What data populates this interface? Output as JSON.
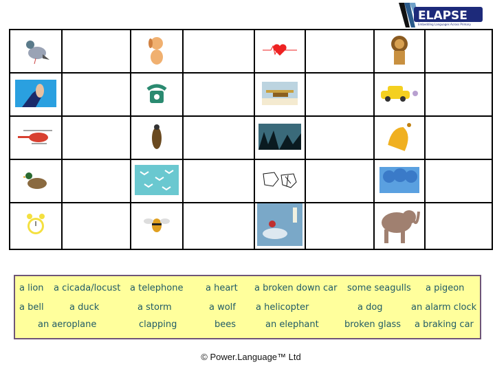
{
  "logo": {
    "text": "ELAPSE",
    "subtitle": "Embedding Languages Across Primary and Secondary Education"
  },
  "grid": {
    "rows": [
      [
        "pigeon-image",
        "dog-image",
        "heart-image",
        "lion-image"
      ],
      [
        "clapping-image",
        "telephone-image",
        "aeroplane-image",
        "braking-car-image"
      ],
      [
        "helicopter-image",
        "cicada-image",
        "wolf-image",
        "bell-image"
      ],
      [
        "duck-image",
        "seagulls-image",
        "broken-glass-image",
        "storm-image"
      ],
      [
        "alarm-clock-image",
        "bees-image",
        "broken-down-car-image",
        "elephant-image"
      ]
    ]
  },
  "words": [
    "a lion",
    "a cicada/locust",
    "a telephone",
    "a heart",
    "a broken down car",
    "some seagulls",
    "a pigeon",
    "a bell",
    "a duck",
    "a storm",
    "a wolf",
    "a helicopter",
    "a dog",
    "an alarm clock",
    "an aeroplane",
    "clapping",
    "bees",
    "an elephant",
    "broken glass",
    "a braking car"
  ],
  "footer": "© Power.Language™ Ltd",
  "colors": {
    "box_bg": "#ffff9c",
    "box_border": "#6e5577",
    "word_text": "#1f5a66"
  }
}
